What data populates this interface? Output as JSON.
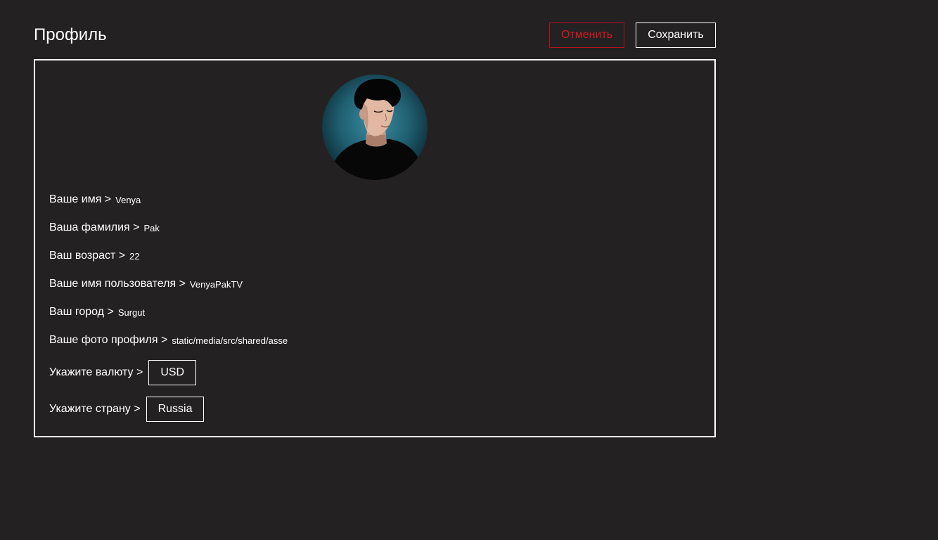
{
  "header": {
    "title": "Профиль",
    "cancel_label": "Отменить",
    "save_label": "Сохранить"
  },
  "profile": {
    "avatar_icon": "user-avatar-photo",
    "fields": [
      {
        "label": "Ваше имя >",
        "value": "Venya"
      },
      {
        "label": "Ваша фамилия >",
        "value": "Pak"
      },
      {
        "label": "Ваш возраст >",
        "value": "22"
      },
      {
        "label": "Ваше имя пользователя >",
        "value": "VenyaPakTV"
      },
      {
        "label": "Ваш город >",
        "value": "Surgut"
      },
      {
        "label": "Ваше фото профиля >",
        "value": "static/media/src/shared/asse"
      }
    ],
    "currency": {
      "label": "Укажите валюту >",
      "value": "USD"
    },
    "country": {
      "label": "Укажите страну >",
      "value": "Russia"
    }
  },
  "colors": {
    "background": "#242123",
    "accent_danger": "#d01b22",
    "text": "#ffffff"
  }
}
